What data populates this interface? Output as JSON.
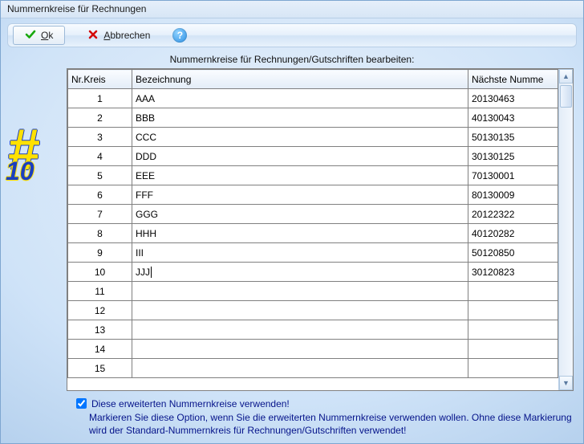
{
  "window": {
    "title": "Nummernkreise für Rechnungen"
  },
  "toolbar": {
    "ok_pre": "O",
    "ok_post": "k",
    "cancel_pre": "A",
    "cancel_post": "bbrechen",
    "help": "?"
  },
  "subtitle": "Nummernkreise für Rechnungen/Gutschriften bearbeiten:",
  "side": {
    "hash": "#",
    "ten": "10"
  },
  "table": {
    "headers": {
      "nr": "Nr.Kreis",
      "bez": "Bezeichnung",
      "next": "Nächste Numme"
    },
    "rows": [
      {
        "nr": "1",
        "bez": "AAA",
        "next": "20130463"
      },
      {
        "nr": "2",
        "bez": "BBB",
        "next": "40130043"
      },
      {
        "nr": "3",
        "bez": "CCC",
        "next": "50130135"
      },
      {
        "nr": "4",
        "bez": "DDD",
        "next": "30130125"
      },
      {
        "nr": "5",
        "bez": "EEE",
        "next": "70130001"
      },
      {
        "nr": "6",
        "bez": "FFF",
        "next": "80130009"
      },
      {
        "nr": "7",
        "bez": "GGG",
        "next": "20122322"
      },
      {
        "nr": "8",
        "bez": "HHH",
        "next": "40120282"
      },
      {
        "nr": "9",
        "bez": "III",
        "next": "50120850"
      },
      {
        "nr": "10",
        "bez": "JJJ",
        "next": "30120823",
        "editing": true
      },
      {
        "nr": "11",
        "bez": "",
        "next": ""
      },
      {
        "nr": "12",
        "bez": "",
        "next": ""
      },
      {
        "nr": "13",
        "bez": "",
        "next": ""
      },
      {
        "nr": "14",
        "bez": "",
        "next": ""
      },
      {
        "nr": "15",
        "bez": "",
        "next": ""
      }
    ]
  },
  "footer": {
    "checkbox_label": "Diese erweiterten Nummernkreise verwenden!",
    "checkbox_checked": true,
    "hint": "Markieren Sie diese Option, wenn Sie die erweiterten Nummernkreise verwenden wollen. Ohne diese Markierung wird der Standard-Nummernkreis für Rechnungen/Gutschriften verwendet!"
  }
}
